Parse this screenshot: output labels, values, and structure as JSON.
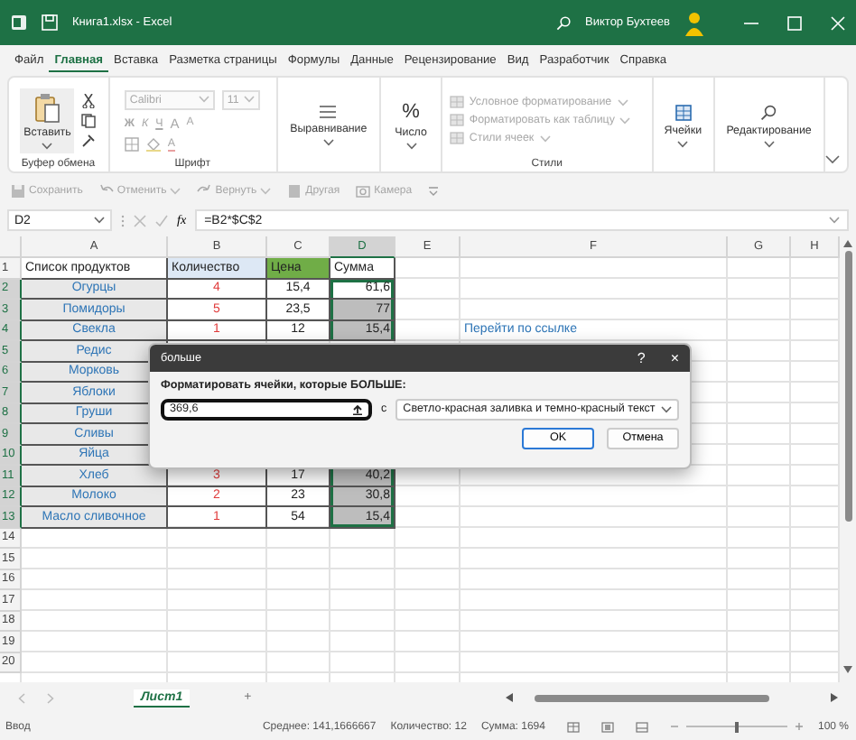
{
  "window": {
    "title": "Книга1.xlsx - Excel",
    "user": "Виктор Бухтеев"
  },
  "menu_tabs": [
    {
      "label": "Файл",
      "selected": false
    },
    {
      "label": "Главная",
      "selected": true
    },
    {
      "label": "Вставка",
      "selected": false
    },
    {
      "label": "Разметка страницы",
      "selected": false
    },
    {
      "label": "Формулы",
      "selected": false
    },
    {
      "label": "Данные",
      "selected": false
    },
    {
      "label": "Рецензирование",
      "selected": false
    },
    {
      "label": "Вид",
      "selected": false
    },
    {
      "label": "Разработчик",
      "selected": false
    },
    {
      "label": "Справка",
      "selected": false
    }
  ],
  "ribbon": {
    "groups": [
      {
        "kind": "clipboard",
        "label": "Буфер обмена",
        "disabled": false,
        "paste": "Вставить"
      },
      {
        "kind": "font",
        "label": "Шрифт",
        "disabled": true,
        "font_name": "Calibri",
        "font_size": "11",
        "buttons": [
          "Ж",
          "К",
          "Ч"
        ],
        "size_buttons": [
          "A",
          "A"
        ],
        "font_color": "A"
      },
      {
        "kind": "alignment",
        "title": "Выравнивание",
        "disabled": false
      },
      {
        "kind": "number",
        "title": "Число",
        "symbol": "%",
        "disabled": false
      },
      {
        "kind": "styles",
        "label": "Стили",
        "disabled": true,
        "items": [
          "Условное форматирование",
          "Форматировать как таблицу",
          "Стили ячеек"
        ]
      },
      {
        "kind": "cells",
        "title": "Ячейки",
        "disabled": false
      },
      {
        "kind": "editing",
        "title": "Редактирование",
        "disabled": false
      }
    ]
  },
  "quick_access": [
    {
      "label": "Сохранить",
      "kind": "save",
      "disabled": true
    },
    {
      "label": "Отменить",
      "kind": "undo",
      "disabled": true
    },
    {
      "label": "Вернуть",
      "kind": "redo",
      "disabled": true
    },
    {
      "label": "Другая",
      "kind": "doc",
      "disabled": true
    },
    {
      "label": "Камера",
      "kind": "camera",
      "disabled": true
    }
  ],
  "formula_bar": {
    "name_box": "D2",
    "fx": "fx",
    "formula": "=B2*$C$2"
  },
  "sheet": {
    "columns": [
      {
        "label": "A",
        "selected": false
      },
      {
        "label": "B",
        "selected": false
      },
      {
        "label": "C",
        "selected": false
      },
      {
        "label": "D",
        "selected": true
      },
      {
        "label": "E",
        "selected": false
      },
      {
        "label": "F",
        "selected": false
      },
      {
        "label": "G",
        "selected": false
      },
      {
        "label": "H",
        "selected": false
      }
    ],
    "rows": [
      {
        "number": "1",
        "kind": "header",
        "in_selection": false,
        "a": "Список продуктов",
        "b": "Количество",
        "c": "Цена",
        "d": "Сумма"
      },
      {
        "number": "2",
        "kind": "data",
        "in_selection": true,
        "active": true,
        "a": "Огурцы",
        "b": "4",
        "c": "15,4",
        "d": "61,6"
      },
      {
        "number": "3",
        "kind": "data",
        "in_selection": true,
        "a": "Помидоры",
        "b": "5",
        "c": "23,5",
        "d": "77"
      },
      {
        "number": "4",
        "kind": "data",
        "in_selection": true,
        "a": "Свекла",
        "b": "1",
        "c": "12",
        "d": "15,4",
        "f": "Перейти по ссылке"
      },
      {
        "number": "5",
        "kind": "data",
        "in_selection": true,
        "a": "Редис"
      },
      {
        "number": "6",
        "kind": "data",
        "in_selection": true,
        "a": "Морковь"
      },
      {
        "number": "7",
        "kind": "data",
        "in_selection": true,
        "a": "Яблоки"
      },
      {
        "number": "8",
        "kind": "data",
        "in_selection": true,
        "a": "Груши"
      },
      {
        "number": "9",
        "kind": "data",
        "in_selection": true,
        "a": "Сливы"
      },
      {
        "number": "10",
        "kind": "data",
        "in_selection": true,
        "a": "Яйца"
      },
      {
        "number": "11",
        "kind": "data",
        "in_selection": true,
        "a": "Хлеб",
        "b": "3",
        "c": "17",
        "d": "40,2"
      },
      {
        "number": "12",
        "kind": "data",
        "in_selection": true,
        "a": "Молоко",
        "b": "2",
        "c": "23",
        "d": "30,8"
      },
      {
        "number": "13",
        "kind": "data",
        "in_selection": true,
        "a": "Масло сливочное",
        "b": "1",
        "c": "54",
        "d": "15,4"
      },
      {
        "number": "14",
        "kind": "empty",
        "in_selection": false
      },
      {
        "number": "15",
        "kind": "empty",
        "in_selection": false
      },
      {
        "number": "16",
        "kind": "empty",
        "in_selection": false
      },
      {
        "number": "17",
        "kind": "empty",
        "in_selection": false
      },
      {
        "number": "18",
        "kind": "empty",
        "in_selection": false
      },
      {
        "number": "19",
        "kind": "empty",
        "in_selection": false
      },
      {
        "number": "20",
        "kind": "empty",
        "in_selection": false
      }
    ]
  },
  "dialog": {
    "title": "больше",
    "help": "?",
    "close": "×",
    "prompt": "Форматировать ячейки, которые БОЛЬШЕ:",
    "value": "369,6",
    "with_label": "с",
    "format": "Светло-красная заливка и темно-красный текст",
    "buttons": [
      {
        "label": "OK",
        "kind": "primary"
      },
      {
        "label": "Отмена",
        "kind": "secondary"
      }
    ]
  },
  "sheet_tabs": {
    "tabs": [
      {
        "label": "Лист1",
        "selected": true
      }
    ],
    "add": "+"
  },
  "status_bar": {
    "mode": "Ввод",
    "average": "Среднее: 141,1666667",
    "count": "Количество: 12",
    "sum": "Сумма: 1694",
    "zoom": {
      "level": 0.5,
      "reading": "100 %"
    }
  }
}
